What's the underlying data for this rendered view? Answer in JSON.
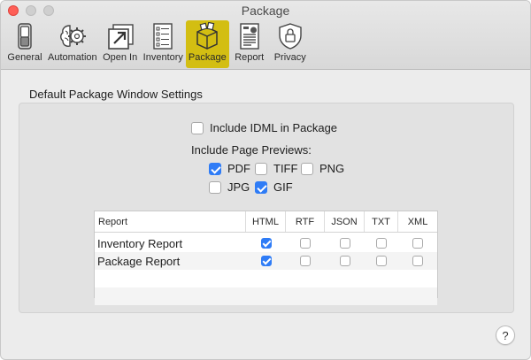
{
  "window": {
    "title": "Package"
  },
  "toolbar": {
    "items": [
      {
        "label": "General",
        "icon": "toggle-switch-icon"
      },
      {
        "label": "Automation",
        "icon": "brain-gear-icon"
      },
      {
        "label": "Open In",
        "icon": "open-in-arrow-icon"
      },
      {
        "label": "Inventory",
        "icon": "checklist-icon"
      },
      {
        "label": "Package",
        "icon": "package-box-icon",
        "active": true
      },
      {
        "label": "Report",
        "icon": "report-document-icon"
      },
      {
        "label": "Privacy",
        "icon": "privacy-shield-lock-icon"
      }
    ],
    "active_color": "#d3be12"
  },
  "section": {
    "title": "Default Package Window Settings"
  },
  "options": {
    "include_idml": {
      "label": "Include IDML in Package",
      "checked": false
    },
    "previews_label": "Include Page Previews:",
    "previews": [
      {
        "label": "PDF",
        "checked": true
      },
      {
        "label": "TIFF",
        "checked": false
      },
      {
        "label": "PNG",
        "checked": false
      },
      {
        "label": "JPG",
        "checked": false
      },
      {
        "label": "GIF",
        "checked": true
      }
    ]
  },
  "report_table": {
    "columns": [
      "Report",
      "HTML",
      "RTF",
      "JSON",
      "TXT",
      "XML"
    ],
    "rows": [
      {
        "name": "Inventory Report",
        "values": [
          true,
          false,
          false,
          false,
          false
        ]
      },
      {
        "name": "Package Report",
        "values": [
          true,
          false,
          false,
          false,
          false
        ]
      }
    ]
  },
  "help": {
    "label": "?"
  },
  "colors": {
    "accent": "#2f7cf6",
    "close": "#fe5f57"
  }
}
